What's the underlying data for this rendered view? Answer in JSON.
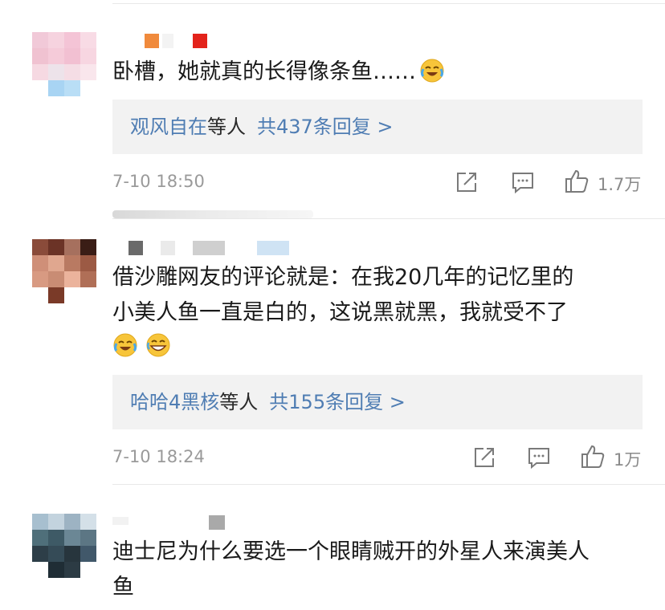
{
  "comments": [
    {
      "text": "卧槽，她就真的长得像条鱼……",
      "reply_users": "观风自在",
      "reply_suffix": "等人",
      "reply_count": "共437条回复 >",
      "time": "7-10 18:50",
      "likes": "1.7万"
    },
    {
      "text_line1": "借沙雕网友的评论就是：在我20几年的记忆里的",
      "text_line2": "小美人鱼一直是白的，这说黑就黑，我就受不了",
      "reply_users": "哈哈4黑核",
      "reply_suffix": "等人",
      "reply_count": "共155条回复 >",
      "time": "7-10 18:24",
      "likes": "1万"
    },
    {
      "text_line1": "迪士尼为什么要选一个眼睛贼开的外星人来演美人",
      "text_line2": "鱼"
    }
  ],
  "icons": [
    "share-icon",
    "comment-icon",
    "like-icon",
    "laugh-cry-emoji-icon",
    "grin-emoji-icon"
  ],
  "colors": {
    "link": "#4f7db3",
    "reply_bg": "#f2f2f2",
    "meta": "#9a9a9a"
  }
}
